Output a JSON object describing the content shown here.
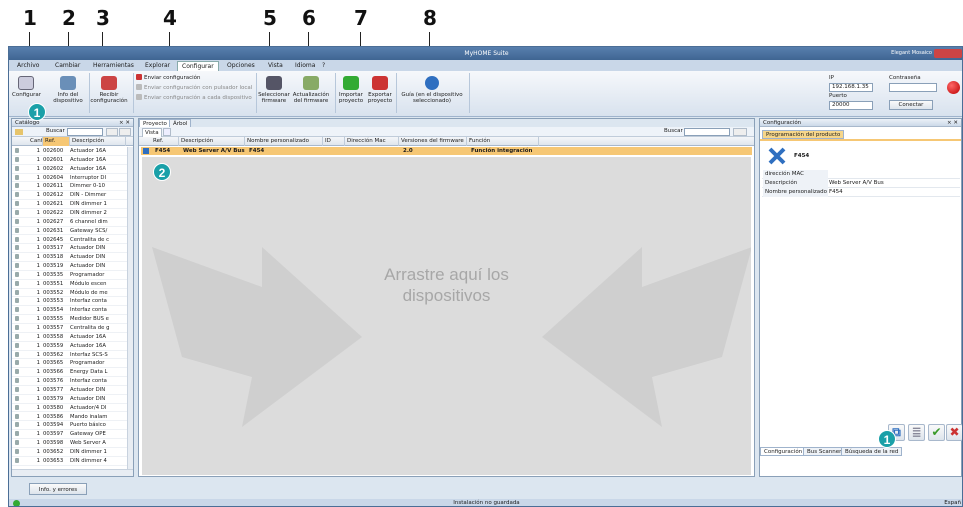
{
  "callouts": [
    "1",
    "2",
    "3",
    "4",
    "5",
    "6",
    "7",
    "8"
  ],
  "badges": {
    "catalog": "1",
    "drop": "2",
    "right": "1"
  },
  "window": {
    "title": "MyHOME Suite",
    "user": "Elegant Mosaico"
  },
  "menu": [
    "Archivo",
    "Cambiar",
    "Herramientas",
    "Explorar",
    "Configurar",
    "Opciones",
    "Vista",
    "Idioma",
    "?"
  ],
  "ribbon": {
    "configurar": "Configurar",
    "info": "Info del dispositivo",
    "recibir": "Recibir configuración",
    "enviar": "Enviar configuración",
    "enviar_pulsador": "Enviar configuración con pulsador local",
    "enviar_cada": "Enviar configuración a cada dispositivo",
    "seleccionar_fw": "Seleccionar firmware",
    "actualizacion_fw": "Actualización del firmware",
    "importar": "Importar proyecto",
    "exportar": "Exportar proyecto",
    "guia": "Guía (en el dispositivo seleccionado)"
  },
  "connection": {
    "ip_label": "IP",
    "ip_value": "192.168.1.35",
    "password_label": "Contraseña",
    "port_label": "Puerto",
    "port_value": "20000",
    "connect_label": "Conectar"
  },
  "catalog": {
    "title": "Catálogo",
    "search_label": "Buscar",
    "columns": [
      "Cant.",
      "Ref.",
      "Descripción"
    ],
    "rows": [
      {
        "q": "1",
        "ref": "002600",
        "desc": "Actuador 16A"
      },
      {
        "q": "1",
        "ref": "002601",
        "desc": "Actuador 16A"
      },
      {
        "q": "1",
        "ref": "002602",
        "desc": "Actuador 16A"
      },
      {
        "q": "1",
        "ref": "002604",
        "desc": "Interruptor DI"
      },
      {
        "q": "1",
        "ref": "002611",
        "desc": "Dimmer 0-10"
      },
      {
        "q": "1",
        "ref": "002612",
        "desc": "DIN - Dimmer"
      },
      {
        "q": "1",
        "ref": "002621",
        "desc": "DIN dimmer 1"
      },
      {
        "q": "1",
        "ref": "002622",
        "desc": "DIN dimmer 2"
      },
      {
        "q": "1",
        "ref": "002627",
        "desc": "6 channel dim"
      },
      {
        "q": "1",
        "ref": "002631",
        "desc": "Gateway SCS/"
      },
      {
        "q": "1",
        "ref": "002645",
        "desc": "Centralita de c"
      },
      {
        "q": "1",
        "ref": "003517",
        "desc": "Actuador DIN"
      },
      {
        "q": "1",
        "ref": "003518",
        "desc": "Actuador DIN"
      },
      {
        "q": "1",
        "ref": "003519",
        "desc": "Actuador DIN"
      },
      {
        "q": "1",
        "ref": "003535",
        "desc": "Programador"
      },
      {
        "q": "1",
        "ref": "003551",
        "desc": "Módulo escen"
      },
      {
        "q": "1",
        "ref": "003552",
        "desc": "Módulo de me"
      },
      {
        "q": "1",
        "ref": "003553",
        "desc": "Interfaz conta"
      },
      {
        "q": "1",
        "ref": "003554",
        "desc": "Interfaz conta"
      },
      {
        "q": "1",
        "ref": "003555",
        "desc": "Medidor BUS e"
      },
      {
        "q": "1",
        "ref": "003557",
        "desc": "Centralita de g"
      },
      {
        "q": "1",
        "ref": "003558",
        "desc": "Actuador 16A"
      },
      {
        "q": "1",
        "ref": "003559",
        "desc": "Actuador 16A"
      },
      {
        "q": "1",
        "ref": "003562",
        "desc": "Interfaz SCS-S"
      },
      {
        "q": "1",
        "ref": "003565",
        "desc": "Programador"
      },
      {
        "q": "1",
        "ref": "003566",
        "desc": "Energy Data L"
      },
      {
        "q": "1",
        "ref": "003576",
        "desc": "Interfaz conta"
      },
      {
        "q": "1",
        "ref": "003577",
        "desc": "Actuador DIN"
      },
      {
        "q": "1",
        "ref": "003579",
        "desc": "Actuador DIN"
      },
      {
        "q": "1",
        "ref": "003580",
        "desc": "Actuador/4 DI"
      },
      {
        "q": "1",
        "ref": "003586",
        "desc": "Mando inalam"
      },
      {
        "q": "1",
        "ref": "003594",
        "desc": "Puerto básico"
      },
      {
        "q": "1",
        "ref": "003597",
        "desc": "Gateway OPE"
      },
      {
        "q": "1",
        "ref": "003598",
        "desc": "Web Server A"
      },
      {
        "q": "1",
        "ref": "003652",
        "desc": "DIN dimmer 1"
      },
      {
        "q": "1",
        "ref": "003653",
        "desc": "DIN dimmer 4"
      }
    ]
  },
  "project": {
    "tabs": [
      "Proyecto",
      "Árbol"
    ],
    "vista": "Vista",
    "search_label": "Buscar",
    "columns": [
      "Ref.",
      "Descripción",
      "Nombre personalizado",
      "ID",
      "Dirección Mac",
      "Versiones del firmware",
      "Función"
    ],
    "row": {
      "ref": "F454",
      "desc": "Web Server A/V Bus",
      "name": "F454",
      "id": "",
      "mac": "",
      "fw": "2.0",
      "func": "Función integración"
    },
    "drop_line1": "Arrastre aquí los",
    "drop_line2": "dispositivos"
  },
  "config_panel": {
    "title": "Configuración",
    "tab": "Programación del producto",
    "device": "F454",
    "props": [
      {
        "k": "dirección MAC",
        "v": ""
      },
      {
        "k": "Descripción",
        "v": "Web Server A/V Bus"
      },
      {
        "k": "Nombre personalizado",
        "v": "F454"
      }
    ],
    "bottom_tabs": [
      "Configuración",
      "Bus Scanner",
      "Búsqueda de la red"
    ]
  },
  "info_button": "Info. y errores",
  "status": {
    "center": "Instalación no guardada",
    "right": "Españ"
  },
  "colors": {
    "accent": "#1aa0a8",
    "row_highlight": "#f6c774",
    "titlebar": "#4a6f9c"
  }
}
